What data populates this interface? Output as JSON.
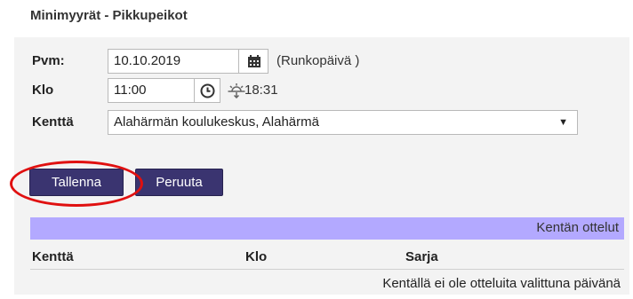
{
  "header": {
    "title": "Minimyyrät - Pikkupeikot"
  },
  "form": {
    "date": {
      "label": "Pvm:",
      "value": "10.10.2019",
      "note": "(Runkopäivä )"
    },
    "time": {
      "label": "Klo",
      "value": "11:00",
      "sunset": "18:31"
    },
    "field": {
      "label": "Kenttä",
      "selected": "Alahärmän koulukeskus, Alahärmä"
    }
  },
  "actions": {
    "save_label": "Tallenna",
    "cancel_label": "Peruuta"
  },
  "matches": {
    "title": "Kentän ottelut",
    "columns": [
      "Kenttä",
      "Klo",
      "Sarja"
    ],
    "empty_text": "Kentällä ei ole otteluita valittuna päivänä"
  },
  "colors": {
    "button": "#3a3470",
    "header_bar": "#b3a9ff",
    "highlight": "#e01010"
  }
}
